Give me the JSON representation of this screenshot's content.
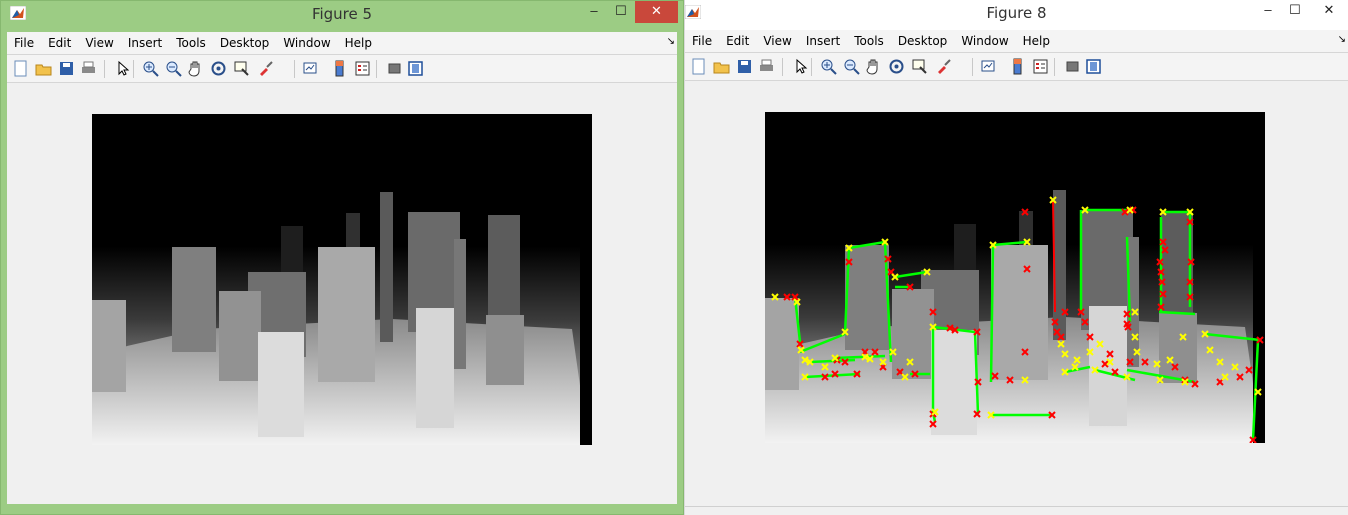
{
  "windows": [
    {
      "title": "Figure 5",
      "controls": {
        "minimize": "‒",
        "maximize": "☐",
        "close": "✕"
      },
      "menu": [
        "File",
        "Edit",
        "View",
        "Insert",
        "Tools",
        "Desktop",
        "Window",
        "Help"
      ],
      "dock_arrow": "↘"
    },
    {
      "title": "Figure 8",
      "controls": {
        "minimize": "‒",
        "maximize": "☐",
        "close": "✕"
      },
      "menu": [
        "File",
        "Edit",
        "View",
        "Insert",
        "Tools",
        "Desktop",
        "Window",
        "Help"
      ],
      "dock_arrow": "↘"
    }
  ],
  "toolbar_icons": [
    "new-figure-icon",
    "open-file-icon",
    "save-icon",
    "print-icon",
    "edit-plot-arrow-icon",
    "zoom-in-icon",
    "zoom-out-icon",
    "pan-hand-icon",
    "rotate-3d-icon",
    "data-cursor-icon",
    "brush-icon",
    "link-plot-icon",
    "insert-colorbar-icon",
    "insert-legend-icon",
    "hide-plot-tools-icon",
    "show-plot-tools-icon"
  ],
  "colors": {
    "active_titlebar": "#9ccc84",
    "close_button": "#c9483b",
    "edge_line": "#00ff00",
    "corner_marker_yellow": "#ffff00",
    "corner_marker_red": "#ff0000"
  }
}
